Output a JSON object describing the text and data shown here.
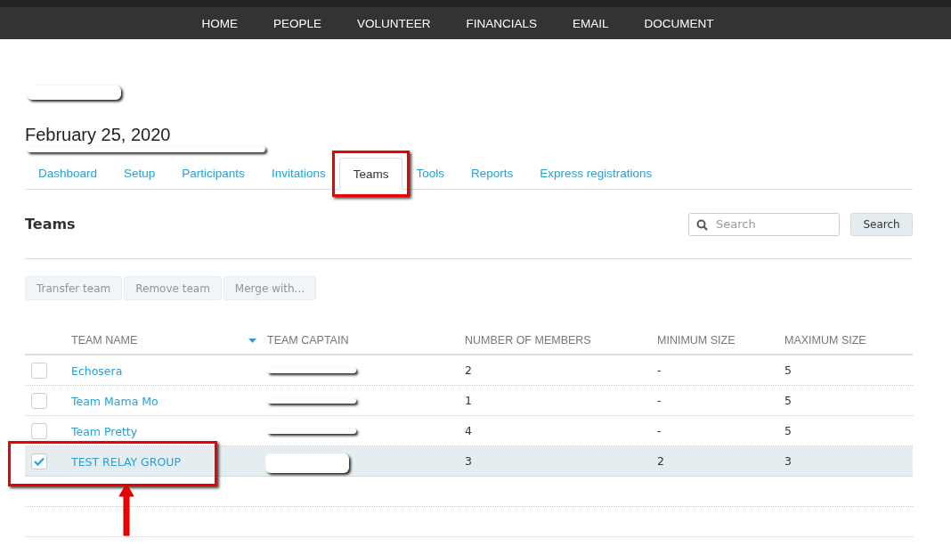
{
  "nav": {
    "items": [
      "HOME",
      "PEOPLE",
      "VOLUNTEER",
      "FINANCIALS",
      "EMAIL",
      "DOCUMENT"
    ]
  },
  "page": {
    "title_redacted": true,
    "date": "February 25, 2020",
    "date_redacted": true
  },
  "tabs": [
    {
      "label": "Dashboard",
      "selected": false,
      "highlighted": false
    },
    {
      "label": "Setup",
      "selected": false,
      "highlighted": false
    },
    {
      "label": "Participants",
      "selected": false,
      "highlighted": false
    },
    {
      "label": "Invitations",
      "selected": false,
      "highlighted": false
    },
    {
      "label": "Teams",
      "selected": true,
      "highlighted": true
    },
    {
      "label": "Tools",
      "selected": false,
      "highlighted": false
    },
    {
      "label": "Reports",
      "selected": false,
      "highlighted": false
    },
    {
      "label": "Express registrations",
      "selected": false,
      "highlighted": false
    }
  ],
  "section": {
    "title": "Teams",
    "search": {
      "placeholder": "Search"
    },
    "search_button": "Search"
  },
  "actions": [
    {
      "label": "Transfer team",
      "disabled": true
    },
    {
      "label": "Remove team",
      "disabled": true
    },
    {
      "label": "Merge with...",
      "disabled": true
    }
  ],
  "table": {
    "columns": [
      {
        "label": "TEAM NAME",
        "sorted": true
      },
      {
        "label": "TEAM CAPTAIN",
        "sorted": false
      },
      {
        "label": "NUMBER OF MEMBERS",
        "sorted": false
      },
      {
        "label": "MINIMUM SIZE",
        "sorted": false
      },
      {
        "label": "MAXIMUM SIZE",
        "sorted": false
      }
    ],
    "rows": [
      {
        "name": "Echosera",
        "captain_redacted": true,
        "members": "2",
        "min": "-",
        "max": "5",
        "selected": false,
        "highlighted": false
      },
      {
        "name": "Team Mama Mo",
        "captain_redacted": true,
        "members": "1",
        "min": "-",
        "max": "5",
        "selected": false,
        "highlighted": false
      },
      {
        "name": "Team Pretty",
        "captain_redacted": true,
        "members": "4",
        "min": "-",
        "max": "5",
        "selected": false,
        "highlighted": false
      },
      {
        "name": "TEST RELAY GROUP",
        "captain_redacted": true,
        "members": "3",
        "min": "2",
        "max": "3",
        "selected": true,
        "highlighted": true
      }
    ]
  }
}
